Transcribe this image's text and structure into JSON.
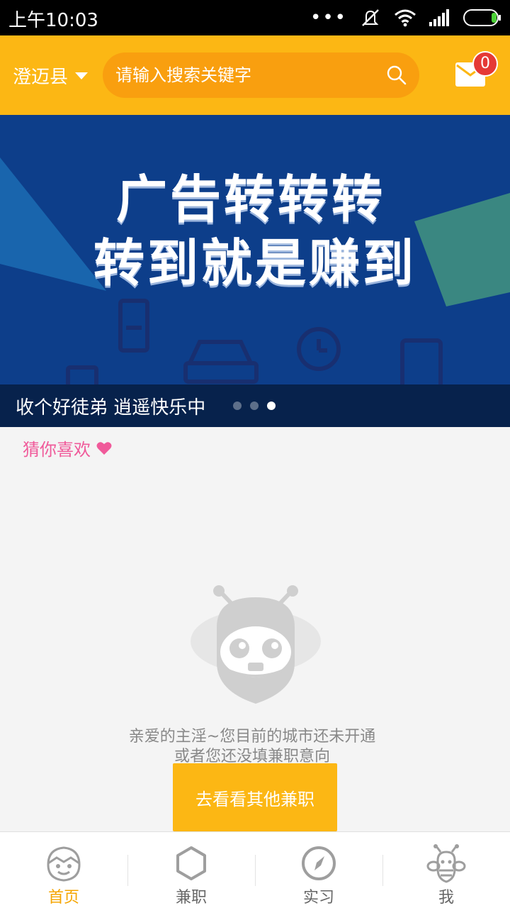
{
  "status_bar": {
    "time": "上午10:03",
    "more": "•••"
  },
  "header": {
    "city": "澄迈县",
    "search_placeholder": "请输入搜索关键字",
    "badge_count": "0"
  },
  "banner": {
    "headline_line1": "广告转转转",
    "headline_line2": "转到就是赚到",
    "caption": "收个好徒弟 逍遥快乐中",
    "slide_count": 3,
    "active_slide": 3
  },
  "guess": {
    "label": "猜你喜欢"
  },
  "empty_state": {
    "line1": "亲爱的主淫~您目前的城市还未开通",
    "line2": "或者您还没填兼职意向",
    "button": "去看看其他兼职"
  },
  "bottom_nav": {
    "items": [
      {
        "label": "首页",
        "icon": "home-icon",
        "active": true
      },
      {
        "label": "兼职",
        "icon": "hexagon-icon",
        "active": false
      },
      {
        "label": "实习",
        "icon": "compass-icon",
        "active": false
      },
      {
        "label": "我",
        "icon": "bee-icon",
        "active": false
      }
    ]
  },
  "colors": {
    "accent": "#fcb714",
    "search_bg": "#f99f0f",
    "banner_bg": "#0d3e8a",
    "pink": "#f05a9a",
    "active_tab": "#f5a500"
  }
}
